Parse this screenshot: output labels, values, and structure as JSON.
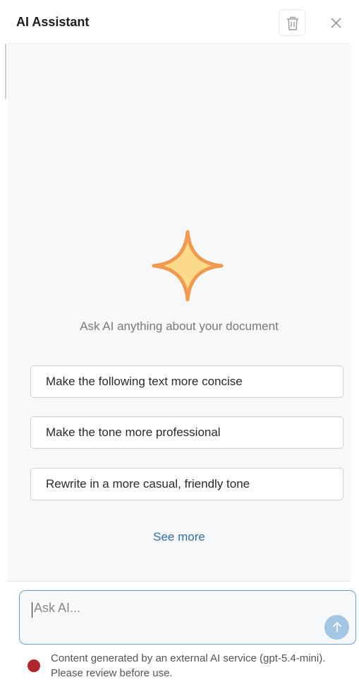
{
  "header": {
    "title": "AI Assistant",
    "trash_icon": "trash-icon",
    "close_icon": "close-icon"
  },
  "main": {
    "hero_icon": "sparkle-icon",
    "prompt": "Ask AI anything about your document",
    "suggestions": [
      "Make the following text more concise",
      "Make the tone more professional",
      "Rewrite in a more casual, friendly tone"
    ],
    "see_more_label": "See more"
  },
  "composer": {
    "placeholder": "Ask AI...",
    "send_icon": "arrow-up-icon"
  },
  "footer": {
    "disclaimer": "Content generated by an external AI service (gpt-5.4-mini). Please review before use."
  },
  "colors": {
    "accent": "#2e6ea8",
    "sparkle_fill": "#fbd98a",
    "sparkle_stroke": "#ef9a4f",
    "status_dot": "#b3262e",
    "send_button": "#a3c6e4",
    "input_border": "#6b9fd0"
  }
}
